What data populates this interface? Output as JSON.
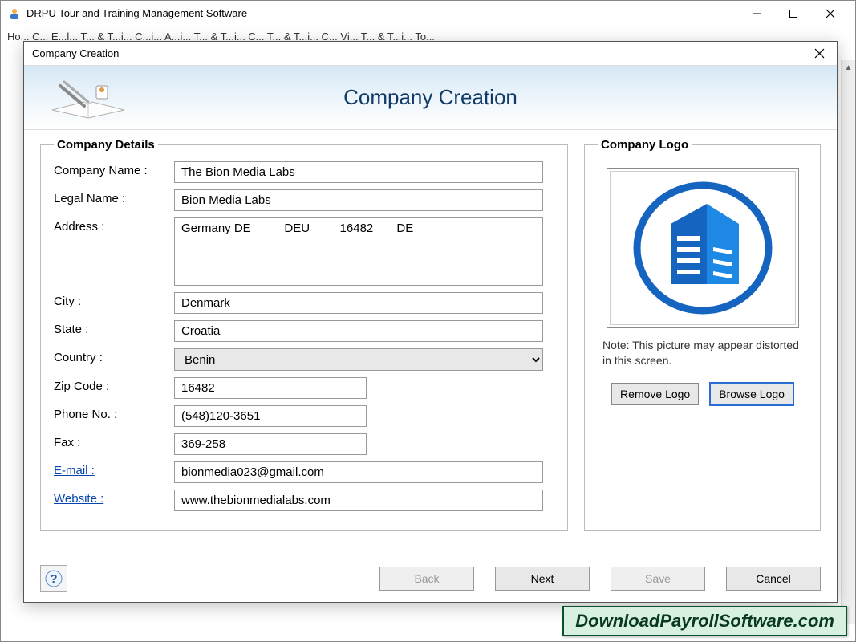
{
  "app": {
    "title": "DRPU Tour and Training Management Software"
  },
  "menubar": {
    "partial_text": "Ho...  C...  E...l...  T... & T...i... C...i...  A...i... T... & T...i...  C... T... & T...i... C...  Vi... T... & T...i...  To..."
  },
  "dialog": {
    "title": "Company Creation",
    "header_title": "Company Creation",
    "details_legend": "Company Details",
    "logo_legend": "Company Logo",
    "labels": {
      "company_name": "Company Name :",
      "legal_name": "Legal Name :",
      "address": "Address :",
      "city": "City :",
      "state": "State :",
      "country": "Country :",
      "zip": "Zip Code :",
      "phone": "Phone No. :",
      "fax": "Fax :",
      "email": "E-mail :",
      "website": "Website :"
    },
    "values": {
      "company_name": "The Bion Media Labs",
      "legal_name": "Bion Media Labs",
      "address": "Germany DE          DEU         16482       DE",
      "city": "Denmark",
      "state": "Croatia",
      "country": "Benin",
      "zip": "16482",
      "phone": "(548)120-3651",
      "fax": "369-258",
      "email": "bionmedia023@gmail.com",
      "website": "www.thebionmedialabs.com"
    },
    "logo": {
      "note": "Note: This picture may appear distorted in this screen.",
      "remove_btn": "Remove Logo",
      "browse_btn": "Browse Logo"
    },
    "buttons": {
      "back": "Back",
      "next": "Next",
      "save": "Save",
      "cancel": "Cancel"
    }
  },
  "watermark": "DownloadPayrollSoftware.com"
}
